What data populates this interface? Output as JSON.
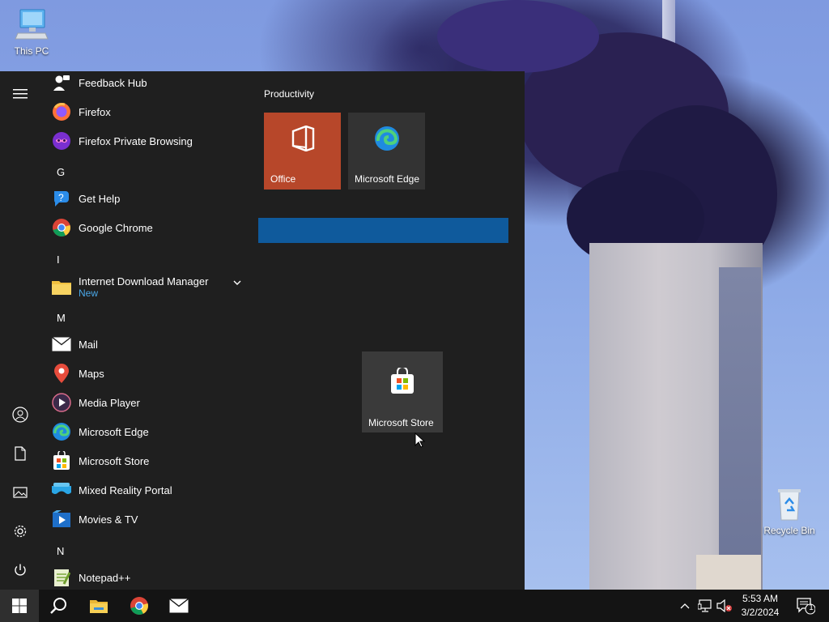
{
  "desktop": {
    "icons": [
      {
        "name": "this-pc",
        "label": "This PC"
      },
      {
        "name": "recycle-bin",
        "label": "Recycle Bin"
      }
    ]
  },
  "start_menu": {
    "apps": [
      {
        "label": "Feedback Hub",
        "icon": "feedback-hub-icon"
      },
      {
        "label": "Firefox",
        "icon": "firefox-icon"
      },
      {
        "label": "Firefox Private Browsing",
        "icon": "firefox-private-icon"
      },
      {
        "letter": "G"
      },
      {
        "label": "Get Help",
        "icon": "get-help-icon"
      },
      {
        "label": "Google Chrome",
        "icon": "chrome-icon"
      },
      {
        "letter": "I"
      },
      {
        "label": "Internet Download Manager",
        "sub": "New",
        "icon": "folder-icon",
        "expandable": true
      },
      {
        "letter": "M"
      },
      {
        "label": "Mail",
        "icon": "mail-icon"
      },
      {
        "label": "Maps",
        "icon": "maps-icon"
      },
      {
        "label": "Media Player",
        "icon": "media-player-icon"
      },
      {
        "label": "Microsoft Edge",
        "icon": "edge-icon"
      },
      {
        "label": "Microsoft Store",
        "icon": "store-icon"
      },
      {
        "label": "Mixed Reality Portal",
        "icon": "mixed-reality-icon"
      },
      {
        "label": "Movies & TV",
        "icon": "movies-tv-icon"
      },
      {
        "letter": "N"
      },
      {
        "label": "Notepad++",
        "icon": "notepadpp-icon"
      }
    ],
    "tiles": {
      "group_title": "Productivity",
      "office": "Office",
      "edge": "Microsoft Edge",
      "dragged": "Microsoft Store"
    },
    "colors": {
      "accent": "#0f5a9c",
      "office": "#b7472a",
      "background": "#1f1f1f"
    }
  },
  "taskbar": {
    "clock_time": "5:53 AM",
    "clock_date": "3/2/2024",
    "notification_count": "1"
  }
}
